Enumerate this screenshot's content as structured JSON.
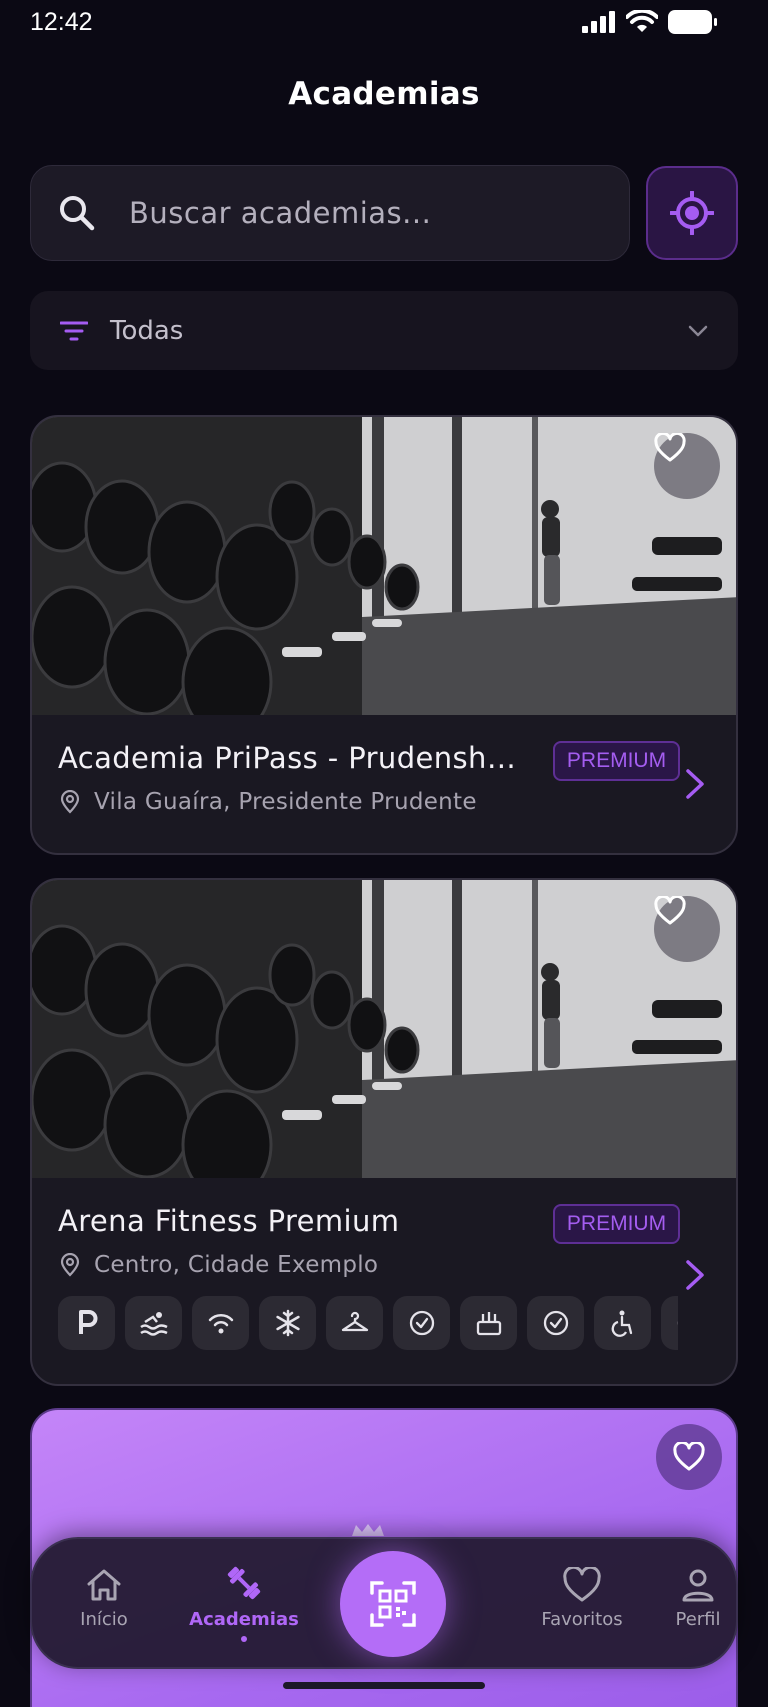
{
  "status_bar": {
    "time": "12:42"
  },
  "page": {
    "title": "Academias"
  },
  "search": {
    "placeholder": "Buscar academias..."
  },
  "filter": {
    "label": "Todas"
  },
  "gyms": [
    {
      "name": "Academia PriPass - Prudensho...",
      "badge": "PREMIUM",
      "location": "Vila Guaíra, Presidente Prudente"
    },
    {
      "name": "Arena Fitness Premium",
      "badge": "PREMIUM",
      "location": "Centro, Cidade Exemplo",
      "amenities": [
        "parking-icon",
        "pool-icon",
        "wifi-icon",
        "air-conditioning-icon",
        "locker-room-icon",
        "check-icon",
        "towel-icon",
        "check-icon",
        "accessibility-icon",
        "more-icon"
      ]
    }
  ],
  "bottom_nav": {
    "items": [
      {
        "label": "Início",
        "icon": "home-icon"
      },
      {
        "label": "Academias",
        "icon": "dumbbell-icon"
      },
      {
        "label": "Favoritos",
        "icon": "heart-icon"
      },
      {
        "label": "Perfil",
        "icon": "user-icon"
      }
    ],
    "active": "Academias",
    "center_icon": "qr-code-icon"
  },
  "colors": {
    "background": "#0b0914",
    "accent": "#b067f7",
    "card": "#1a1822",
    "badge_bg": "#2a1647"
  }
}
